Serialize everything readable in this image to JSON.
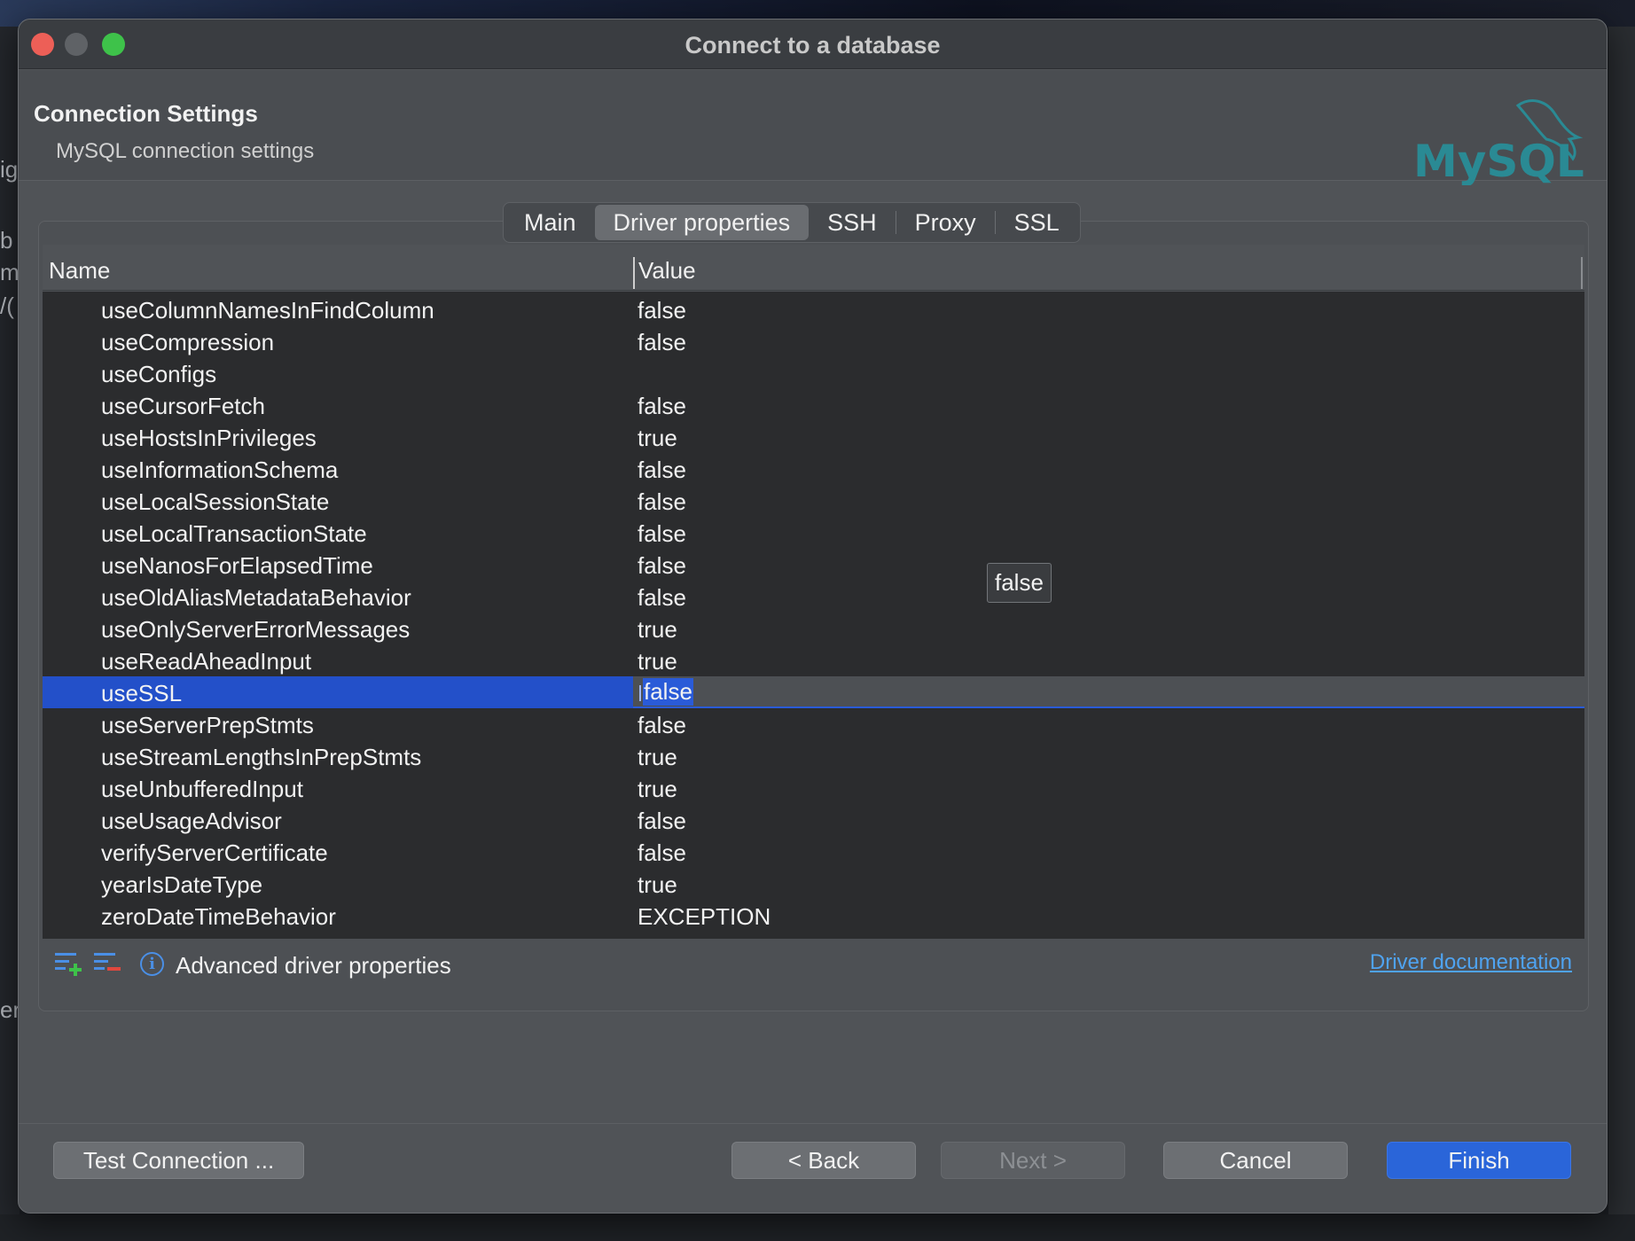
{
  "window": {
    "title": "Connect to a database"
  },
  "header": {
    "title": "Connection Settings",
    "subtitle": "MySQL connection settings",
    "logo_text": "MySQL"
  },
  "tabs": [
    {
      "label": "Main",
      "active": false
    },
    {
      "label": "Driver properties",
      "active": true
    },
    {
      "label": "SSH",
      "active": false
    },
    {
      "label": "Proxy",
      "active": false
    },
    {
      "label": "SSL",
      "active": false
    }
  ],
  "grid": {
    "col_name": "Name",
    "col_value": "Value",
    "rows": [
      {
        "name": "useColumnNamesInFindColumn",
        "value": "false"
      },
      {
        "name": "useCompression",
        "value": "false"
      },
      {
        "name": "useConfigs",
        "value": ""
      },
      {
        "name": "useCursorFetch",
        "value": "false"
      },
      {
        "name": "useHostsInPrivileges",
        "value": "true"
      },
      {
        "name": "useInformationSchema",
        "value": "false"
      },
      {
        "name": "useLocalSessionState",
        "value": "false"
      },
      {
        "name": "useLocalTransactionState",
        "value": "false"
      },
      {
        "name": "useNanosForElapsedTime",
        "value": "false"
      },
      {
        "name": "useOldAliasMetadataBehavior",
        "value": "false"
      },
      {
        "name": "useOnlyServerErrorMessages",
        "value": "true"
      },
      {
        "name": "useReadAheadInput",
        "value": "true"
      },
      {
        "name": "useSSL",
        "value": "false",
        "selected": true
      },
      {
        "name": "useServerPrepStmts",
        "value": "false"
      },
      {
        "name": "useStreamLengthsInPrepStmts",
        "value": "true"
      },
      {
        "name": "useUnbufferedInput",
        "value": "true"
      },
      {
        "name": "useUsageAdvisor",
        "value": "false"
      },
      {
        "name": "verifyServerCertificate",
        "value": "false"
      },
      {
        "name": "yearIsDateType",
        "value": "true"
      },
      {
        "name": "zeroDateTimeBehavior",
        "value": "EXCEPTION"
      }
    ],
    "tooltip": "false"
  },
  "toolbar": {
    "add_icon": "add-property-icon",
    "remove_icon": "remove-property-icon",
    "info_icon": "info-icon",
    "advanced_label": "Advanced driver properties",
    "doc_link": "Driver documentation"
  },
  "buttons": {
    "test": "Test Connection ...",
    "back": "< Back",
    "next": "Next >",
    "cancel": "Cancel",
    "finish": "Finish"
  },
  "colors": {
    "selection": "#2350c9",
    "finish": "#2a65d9",
    "link": "#4fa3f0",
    "logo_teal": "#2a8a94",
    "logo_orange": "#e48b1d"
  },
  "desktop": {
    "fragments": [
      "ig",
      "b",
      "m",
      "/(",
      "er"
    ]
  }
}
